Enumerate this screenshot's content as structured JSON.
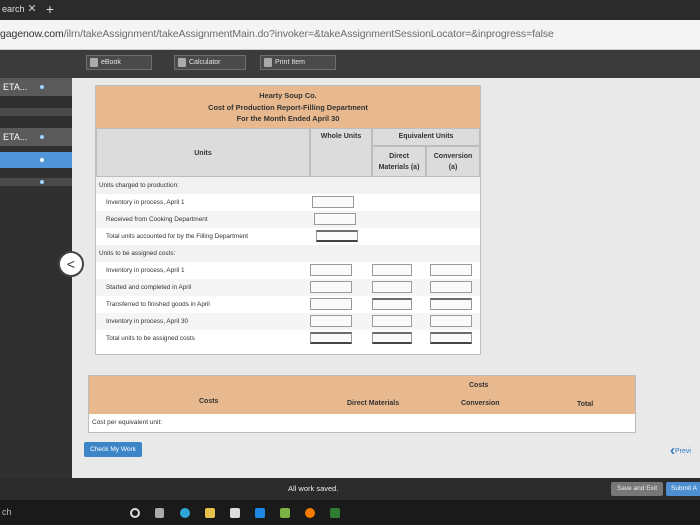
{
  "browser": {
    "tab_label": "earch",
    "url_host": "gagenow.com",
    "url_path": "/ilrn/takeAssignment/takeAssignmentMain.do?invoker=&takeAssignmentSessionLocator=&inprogress=false"
  },
  "toolbar": {
    "ebook": "eBook",
    "calculator": "Calculator",
    "print": "Print Item"
  },
  "sidebar": {
    "items": [
      "ETA...",
      "ETA..."
    ]
  },
  "report": {
    "company": "Hearty Soup Co.",
    "title": "Cost of Production Report-Filling Department",
    "period": "For the Month Ended April 30",
    "col_whole_units": "Whole Units",
    "col_equiv_units": "Equivalent Units",
    "col_units": "Units",
    "col_direct": "Direct",
    "col_materials": "Materials (a)",
    "col_conversion": "Conversion",
    "col_conversion_a": "(a)",
    "section_charged": "Units charged to production:",
    "rows_charged": [
      "Inventory in process, April 1",
      "Received from Cooking Department",
      "Total units accounted for by the Filling Department"
    ],
    "section_assigned": "Units to be assigned costs:",
    "rows_assigned": [
      "Inventory in process, April 1",
      "Started and completed in April",
      "Transferred to finished goods in April",
      "Inventory in process, April 30",
      "Total units to be assigned costs"
    ]
  },
  "costs_table": {
    "top_header": "Costs",
    "col_costs": "Costs",
    "col_direct_materials": "Direct Materials",
    "col_conversion": "Conversion",
    "col_total": "Total",
    "row_label": "Cost per equivalent unit:"
  },
  "actions": {
    "check_my_work": "Check My Work",
    "previous": "Previ",
    "status": "All work saved.",
    "save_exit": "Save and Exit",
    "submit": "Submit A"
  },
  "taskbar": {
    "search_hint": "ch"
  }
}
